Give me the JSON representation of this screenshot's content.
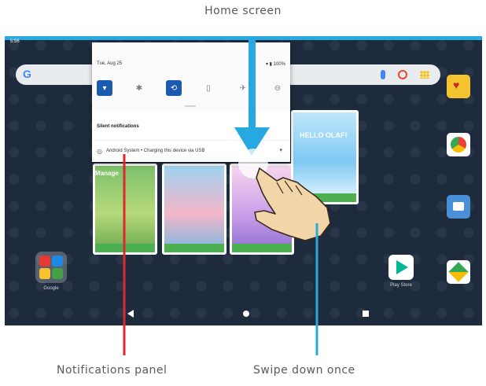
{
  "callouts": {
    "home_screen": "Home screen",
    "notifications_panel": "Notifications panel",
    "swipe_down_once": "Swipe down once"
  },
  "status_bar": {
    "time": "5:56",
    "date": "Tue, Aug 25",
    "battery": "100%"
  },
  "search_bar": {
    "logo": "G"
  },
  "quick_settings": {
    "tiles": [
      {
        "icon": "wifi-icon",
        "glyph": "▾",
        "active": true
      },
      {
        "icon": "bluetooth-icon",
        "glyph": "✱",
        "active": false
      },
      {
        "icon": "auto-rotate-icon",
        "glyph": "⟲",
        "active": true
      },
      {
        "icon": "battery-saver-icon",
        "glyph": "▯",
        "active": false
      },
      {
        "icon": "airplane-mode-icon",
        "glyph": "✈",
        "active": false
      },
      {
        "icon": "do-not-disturb-icon",
        "glyph": "⊖",
        "active": false
      }
    ]
  },
  "notifications": {
    "section_title": "Silent notifications",
    "items": [
      {
        "icon": "usb-icon",
        "text": "Android System • Charging this device via USB"
      }
    ]
  },
  "home": {
    "manage_label": "Manage",
    "frozen_card_title": "HELLO OLAF!",
    "folder_label": "Google",
    "play_store_label": "Play Store"
  },
  "colors": {
    "accent_blue": "#27a8e0",
    "callout_red": "#e0262f",
    "shade_active_tile": "#1a5bb0"
  }
}
